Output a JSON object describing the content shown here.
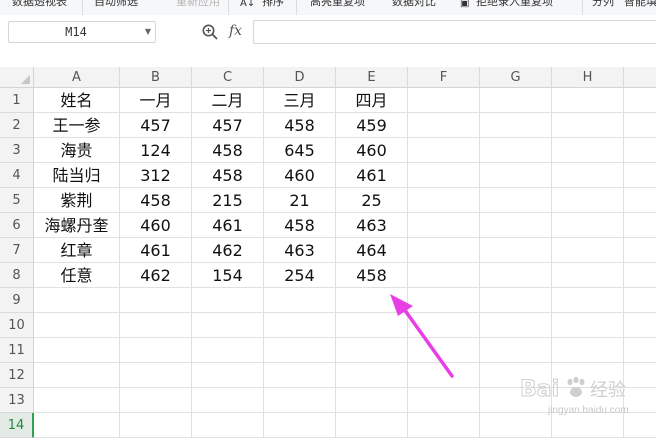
{
  "toolbar": {
    "items": [
      "数据透视表",
      "自动筛选",
      "重新应用",
      "排序",
      "高亮重复项",
      "数据对比",
      "拒绝录入重复项",
      "分列",
      "智能填"
    ]
  },
  "formula_bar": {
    "name_box": "M14",
    "fx": "fx",
    "formula": ""
  },
  "columns": [
    "A",
    "B",
    "C",
    "D",
    "E",
    "F",
    "G",
    "H"
  ],
  "rows": [
    "1",
    "2",
    "3",
    "4",
    "5",
    "6",
    "7",
    "8",
    "9",
    "10",
    "11",
    "12",
    "13",
    "14"
  ],
  "active_row": "14",
  "table": {
    "header": [
      "姓名",
      "一月",
      "二月",
      "三月",
      "四月"
    ],
    "records": [
      [
        "王一参",
        "457",
        "457",
        "458",
        "459"
      ],
      [
        "海贵",
        "124",
        "458",
        "645",
        "460"
      ],
      [
        "陆当归",
        "312",
        "458",
        "460",
        "461"
      ],
      [
        "紫荆",
        "458",
        "215",
        "21",
        "25"
      ],
      [
        "海螺丹奎",
        "460",
        "461",
        "458",
        "463"
      ],
      [
        "红章",
        "461",
        "462",
        "463",
        "464"
      ],
      [
        "任意",
        "462",
        "154",
        "254",
        "458"
      ]
    ]
  },
  "annotation": {
    "color": "#e83ee6"
  },
  "watermark": {
    "logo": "Bai度经验",
    "url": "jingyan.baidu.com"
  },
  "colors": {
    "header_bg": "#f3f3f3",
    "active_green": "#2f9f54",
    "gridline": "#e1e1e1"
  }
}
